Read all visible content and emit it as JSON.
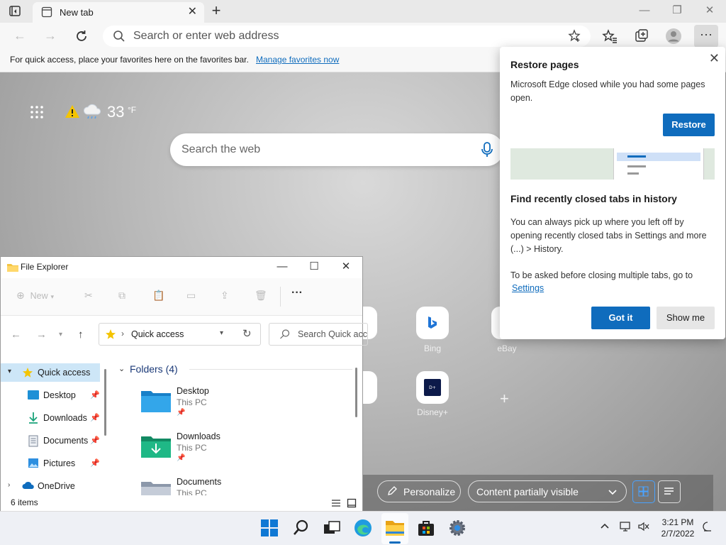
{
  "browser": {
    "tab_title": "New tab",
    "address_placeholder": "Search or enter web address",
    "favbar_message": "For quick access, place your favorites here on the favorites bar.",
    "favbar_link": "Manage favorites now"
  },
  "newtab": {
    "temperature": "33",
    "temperature_unit": "°F",
    "search_placeholder": "Search the web",
    "tiles": [
      {
        "label": "Bing",
        "icon": "bing-icon"
      },
      {
        "label": "eBay",
        "icon": "ebay-icon"
      },
      {
        "label": "Disney+",
        "icon": "disney-plus-icon"
      }
    ],
    "personalize_label": "Personalize",
    "content_visibility": "Content partially visible"
  },
  "flyout": {
    "title": "Restore pages",
    "body": "Microsoft Edge closed while you had some pages open.",
    "restore_label": "Restore",
    "history_title": "Find recently closed tabs in history",
    "history_body": "You can always pick up where you left off by opening recently closed tabs in Settings and more (...) > History.",
    "ask_text": "To be asked before closing multiple tabs, go to",
    "settings_link": "Settings",
    "got_it_label": "Got it",
    "show_me_label": "Show me"
  },
  "explorer": {
    "title": "File Explorer",
    "new_label": "New",
    "address": "Quick access",
    "search_placeholder": "Search Quick access",
    "tree": [
      {
        "label": "Quick access",
        "pinned": false
      },
      {
        "label": "Desktop",
        "pinned": true
      },
      {
        "label": "Downloads",
        "pinned": true
      },
      {
        "label": "Documents",
        "pinned": true
      },
      {
        "label": "Pictures",
        "pinned": true
      },
      {
        "label": "OneDrive",
        "pinned": false
      }
    ],
    "section_title": "Folders (4)",
    "folders": [
      {
        "name": "Desktop",
        "location": "This PC"
      },
      {
        "name": "Downloads",
        "location": "This PC"
      },
      {
        "name": "Documents",
        "location": "This PC"
      }
    ],
    "status": "6 items"
  },
  "taskbar": {
    "time": "3:21 PM",
    "date": "2/7/2022"
  },
  "colors": {
    "accent": "#0f6cbd",
    "folder_blue": "#1e90d6",
    "folder_green": "#1aa37a"
  }
}
